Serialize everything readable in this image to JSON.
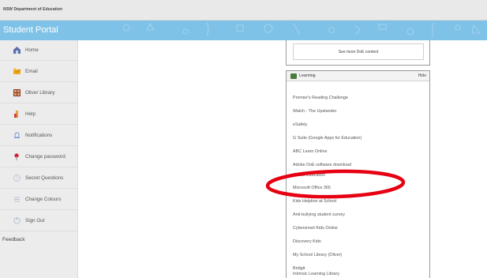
{
  "topbar": {
    "department": "NSW Department of Education"
  },
  "banner": {
    "title": "Student Portal"
  },
  "sidebar": {
    "items": [
      {
        "label": "Home",
        "icon": "home-icon"
      },
      {
        "label": "Email",
        "icon": "email-icon"
      },
      {
        "label": "Oliver Library",
        "icon": "library-icon"
      },
      {
        "label": "Help",
        "icon": "help-icon"
      },
      {
        "label": "Notifications",
        "icon": "bell-icon"
      },
      {
        "label": "Change password",
        "icon": "key-icon"
      },
      {
        "label": "Secret Questions",
        "icon": "question-icon"
      },
      {
        "label": "Change Colours",
        "icon": "palette-icon"
      },
      {
        "label": "Sign Out",
        "icon": "sign-out-icon"
      }
    ],
    "feedback": "Feedback"
  },
  "see_more": {
    "label": "See more DoE content"
  },
  "learning": {
    "title": "Learning",
    "hide": "Hide",
    "links": [
      "Premier's Reading Challenge",
      "Watch - The Upstander",
      "eSafety",
      "G Suite (Google Apps for Education)",
      "ABC Learn Online",
      "Adobe DoE software download",
      "Adobe Education",
      "Microsoft Office 365",
      "Kids Helpline at School",
      "Anti-bullying student survey",
      "Cybersmart Kids Online",
      "Discovery Kids",
      "My School Library (Oliver)",
      "Bridgit",
      "Intrinsic Learning Library"
    ]
  },
  "colors": {
    "banner": "#7fc2e8",
    "annotation": "#e60012",
    "sidebar": "#ececec"
  }
}
